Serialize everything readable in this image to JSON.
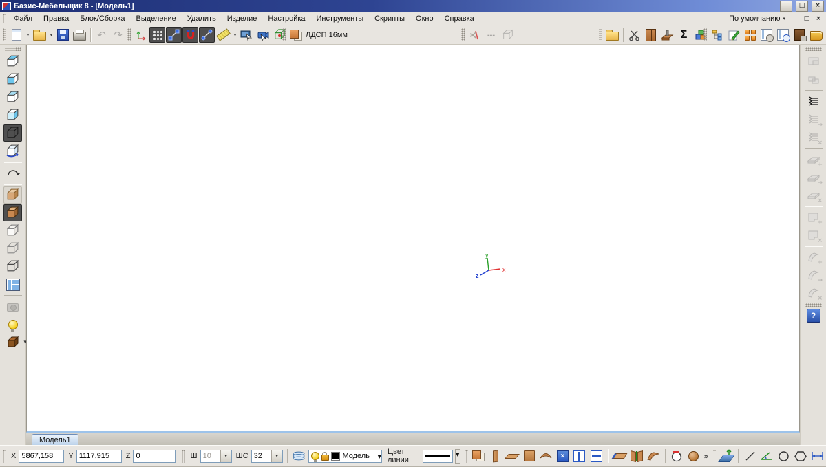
{
  "window": {
    "title": "Базис-Мебельщик 8 - [Модель1]",
    "controls": {
      "minimize": "_",
      "restore": "□",
      "close": "×"
    }
  },
  "menubar": {
    "items": [
      "Файл",
      "Правка",
      "Блок/Сборка",
      "Выделение",
      "Удалить",
      "Изделие",
      "Настройка",
      "Инструменты",
      "Скрипты",
      "Окно",
      "Справка"
    ],
    "profile": "По умолчанию",
    "child_controls": {
      "minimize": "_",
      "restore": "□",
      "close": "×"
    }
  },
  "toolbar": {
    "material_label": "ЛДСП 16мм",
    "dashes_glyph": "---",
    "sigma_glyph": "Σ"
  },
  "glyphs": {
    "dropdown": "▾",
    "undo": "↶",
    "redo": "↷",
    "rotate": "↷",
    "overflow": "»",
    "plus": "+",
    "arrow": "→",
    "x": "×",
    "help": "?"
  },
  "canvas": {
    "axis_labels": {
      "x": "x",
      "y": "y",
      "z": "z"
    }
  },
  "tabbar": {
    "active_tab": "Модель1"
  },
  "statusbar": {
    "x_label": "X",
    "x_value": "5867,158",
    "y_label": "Y",
    "y_value": "1117,915",
    "z_label": "Z",
    "z_value": "0",
    "sh_label": "Ш",
    "sh_value": "10",
    "shs_label": "ШС",
    "shs_value": "32",
    "layer_value": "Модель",
    "line_color_label": "Цвет линии"
  },
  "colors": {
    "titlebar_gradient": [
      "#1E2F75",
      "#8FA6E0"
    ],
    "chrome": "#E8E5E0",
    "canvas": "#FFFFFF",
    "axis_x": "#E03030",
    "axis_y": "#2AA02A",
    "axis_z": "#2040D0",
    "wood": "#C98850",
    "pressed_button_bg": "#4F4F4F",
    "accent_blue": "#2B59C3",
    "tab_fill": "#BCD2EA"
  },
  "icons": {
    "app-icon": "red/blue logo square",
    "new-document-icon": "white page",
    "open-folder-icon": "yellow folder",
    "save-icon": "blue floppy disk",
    "print-icon": "printer",
    "undo-icon": "curved arrow left (disabled)",
    "redo-icon": "curved arrow right (disabled)",
    "axes-icon": "red/green coordinate arrows",
    "grid-icon": "dot grid (pressed)",
    "snap-node-icon": "diagonal with blue squares (pressed)",
    "magnet-icon": "red U magnet with blue tips (pressed)",
    "snap-line-icon": "diagonal with blue dots (pressed)",
    "ruler-icon": "yellow ruler",
    "select-panel-icon": "blue monitor with cursor",
    "select-camera-icon": "blue camera with cursor",
    "assembly-cube-icon": "green wireframe cube",
    "material-icon": "orange square over white sheet",
    "trim-icon": "gray branch with red slash (disabled)",
    "dashes-icon": "dashed line (disabled)",
    "gray-box-icon": "gray wireframe box (disabled)",
    "scissors-icon": "scissors",
    "cabinet-icon": "brown cabinet",
    "drill-icon": "drill over plank",
    "sigma-icon": "sum sign",
    "blocks-icon": "colored cubes",
    "tree-icon": "structure tree",
    "edit-pencil-icon": "green pencil on sheet",
    "orange-squares-icon": "four orange squares",
    "clock-list-icon": "panel with clock",
    "search-list-icon": "panel with magnifier",
    "cabinet-lock-icon": "dark cabinet with lock",
    "book-icon": "orange book",
    "view-cube-icons": "cubes with cyan faces (view orientations)",
    "rotate-view-icon": "curved arrow",
    "wood-cube-icons": "textured/shaded display cubes",
    "wire-cube-icons": "wireframe display cubes",
    "viewport-layout-icon": "split window",
    "camera-icon": "camera (disabled)",
    "light-icon": "yellow bulb",
    "materials-cube-icon": "brown cube with dropdown",
    "edge-band-icons": "comb shapes add/edit/delete",
    "facing-icons": "flat panel add/edit/delete",
    "cutout-icons": "panel add/delete",
    "bend-icons": "bent panel add/edit/delete",
    "help-icon": "blue question mark",
    "layers-icon": "stacked blue layers",
    "bulb-icon": "small yellow bulb",
    "lock-icon": "open padlock",
    "color-swatch": "black square",
    "panel-tool-icons": "wood panel creation tools",
    "divider-icons": "blue divider boxes",
    "plane-3d-icon": "blue plane with arrow",
    "draw-tool-icons": "line, angle, circle, polygon, dimension"
  }
}
